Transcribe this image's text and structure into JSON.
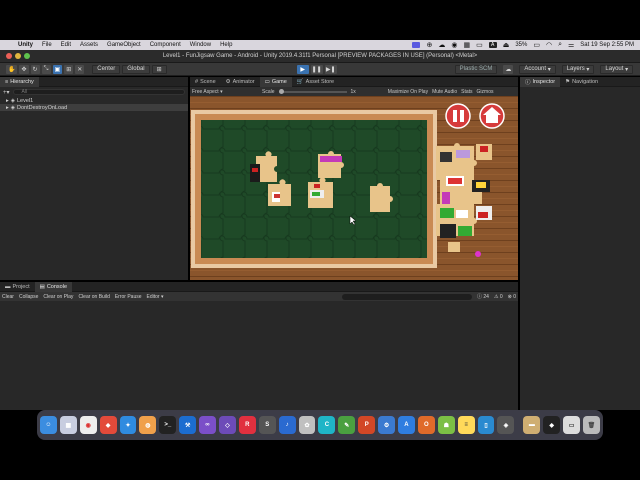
{
  "macbar": {
    "app": "Unity",
    "menus": [
      "File",
      "Edit",
      "Assets",
      "GameObject",
      "Component",
      "Window",
      "Help"
    ],
    "battery": "35%",
    "datetime": "Sat 19 Sep  2:55 PM"
  },
  "window": {
    "title": "Level1 - FunJigsaw Game - Android - Unity 2019.4.31f1 Personal [PREVIEW PACKAGES IN USE] (Personal) <Metal>"
  },
  "toolbar": {
    "pivot": "Center",
    "space": "Global",
    "plastic": "Plastic SCM",
    "account": "Account",
    "layers": "Layers",
    "layout": "Layout"
  },
  "hierarchy": {
    "tab": "Hierarchy",
    "search_placeholder": "All",
    "items": [
      "Level1",
      "DontDestroyOnLoad"
    ]
  },
  "center_tabs": [
    "Scene",
    "Animator",
    "Game",
    "Asset Store"
  ],
  "gamebar": {
    "aspect": "Free Aspect",
    "scale_label": "Scale",
    "scale_value": "1x",
    "maximize": "Maximize On Play",
    "mute": "Mute Audio",
    "stats": "Stats",
    "gizmos": "Gizmos"
  },
  "inspector": {
    "tabs": [
      "Inspector",
      "Navigation"
    ]
  },
  "bottom": {
    "tabs": [
      "Project",
      "Console"
    ],
    "buttons": [
      "Clear",
      "Collapse",
      "Clear on Play",
      "Clear on Build",
      "Error Pause",
      "Editor"
    ],
    "counts": {
      "log": "24",
      "warn": "0",
      "error": "0"
    }
  },
  "dock_apps": [
    "Finder",
    "Launchpad",
    "Chrome",
    "AnyDesk",
    "Safari",
    "Blender",
    "Terminal",
    "Xcode",
    "Visual Studio",
    "VS Code",
    "Rider",
    "Sublime",
    "MP3",
    "Photos",
    "Canva",
    "Pages",
    "PowerPoint",
    "Copilot",
    "App Store",
    "Office",
    "Android",
    "Notes",
    "Simulator",
    "Unity Hub",
    "Finder2",
    "Unity",
    "Screen",
    "Trash"
  ]
}
